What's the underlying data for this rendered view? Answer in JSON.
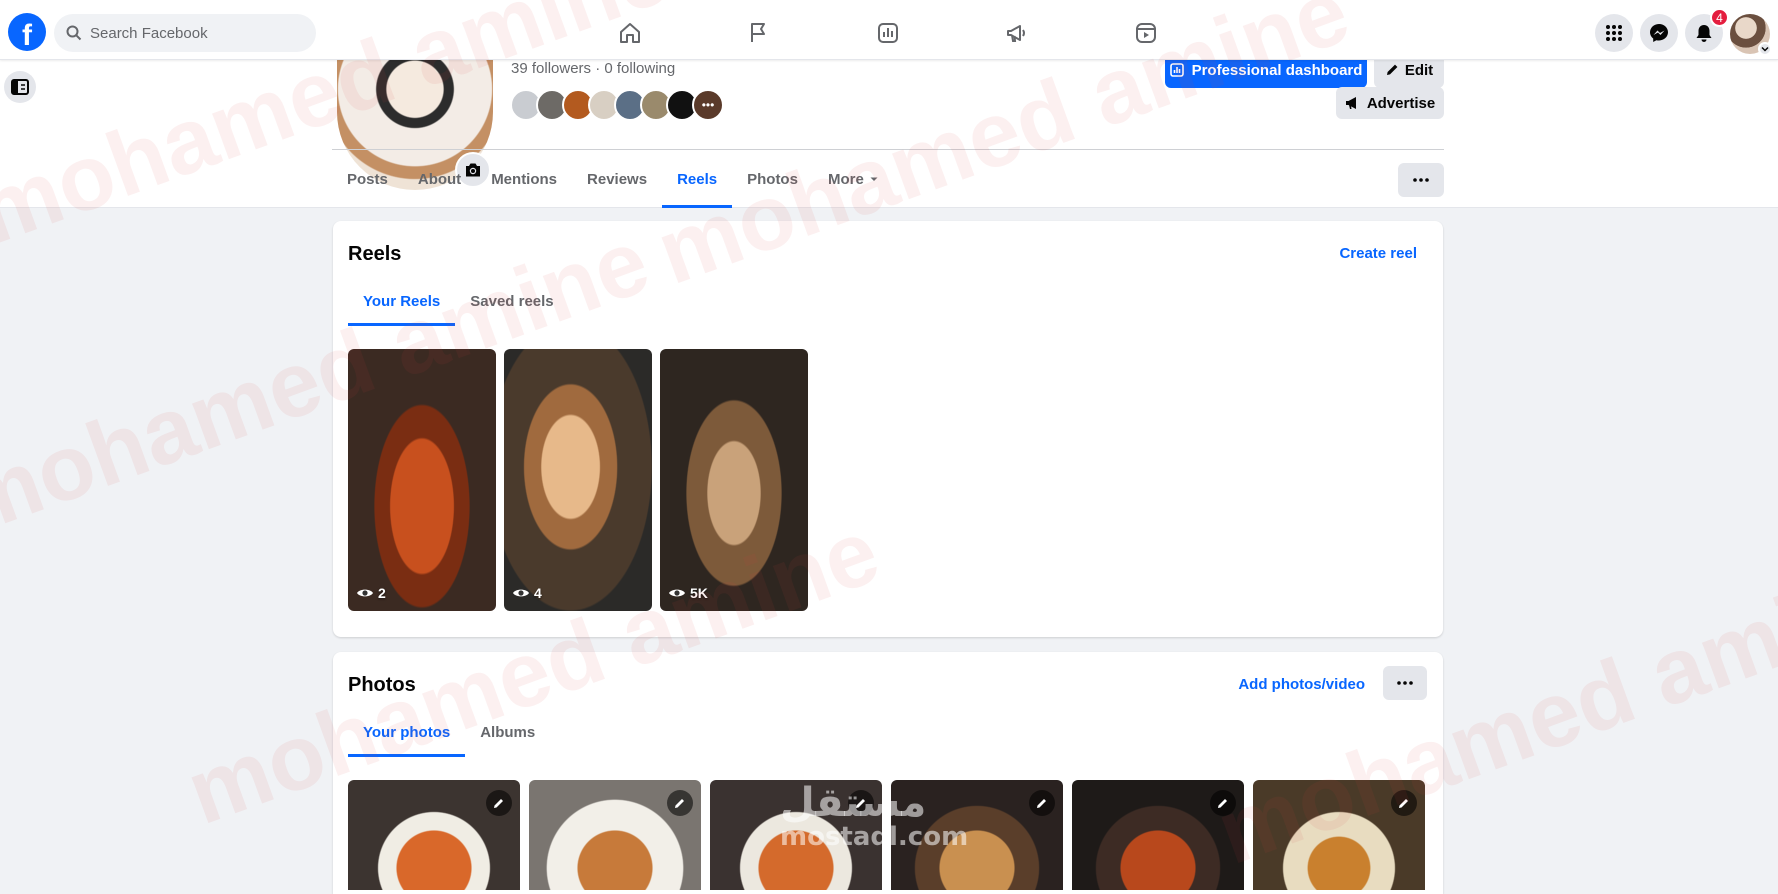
{
  "search": {
    "placeholder": "Search Facebook"
  },
  "notifications": {
    "count": "4"
  },
  "profile": {
    "followers_text": "39 followers · 0 following",
    "professional_dashboard": "Professional dashboard",
    "edit": "Edit",
    "advertise": "Advertise"
  },
  "tabs": [
    {
      "label": "Posts"
    },
    {
      "label": "About"
    },
    {
      "label": "Mentions"
    },
    {
      "label": "Reviews"
    },
    {
      "label": "Reels",
      "active": true
    },
    {
      "label": "Photos"
    },
    {
      "label": "More"
    }
  ],
  "reels": {
    "title": "Reels",
    "create_link": "Create reel",
    "subtabs": [
      "Your Reels",
      "Saved reels"
    ],
    "items": [
      {
        "views": "2"
      },
      {
        "views": "4"
      },
      {
        "views": "5K"
      }
    ]
  },
  "photos": {
    "title": "Photos",
    "add_link": "Add photos/video",
    "subtabs": [
      "Your photos",
      "Albums"
    ]
  },
  "watermark": {
    "text": "mohamed amine",
    "logo": "مستقل",
    "logo_sub": "mostaql.com"
  },
  "colors": {
    "brand": "#0866ff",
    "badge": "#e41e3f",
    "page_bg": "#f0f2f5"
  }
}
